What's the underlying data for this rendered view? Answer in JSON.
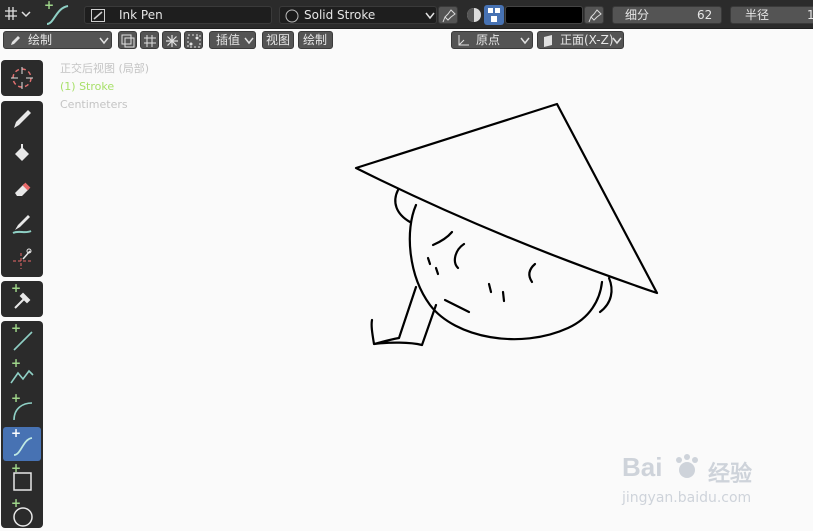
{
  "top": {
    "brush_name": "Ink Pen",
    "material": "Solid Stroke",
    "subdivision_label": "细分",
    "subdivision_value": "62",
    "radius_label": "半径",
    "radius_value": "1"
  },
  "header": {
    "mode": "绘制",
    "interp_label": "插值",
    "view_menu": "视图",
    "draw_menu": "绘制",
    "origin": "原点",
    "plane": "正面(X-Z)"
  },
  "overlay": {
    "view_name": "正交后视图 (局部)",
    "object": "(1) Stroke",
    "units": "Centimeters"
  },
  "watermark": {
    "brand_text": "Bai",
    "brand_suffix": "经验",
    "url": "jingyan.baidu.com"
  },
  "colors": {
    "active_tool": "#4772b3",
    "ui_dark": "#2b2b2b",
    "plus_green": "#9fd68a"
  }
}
